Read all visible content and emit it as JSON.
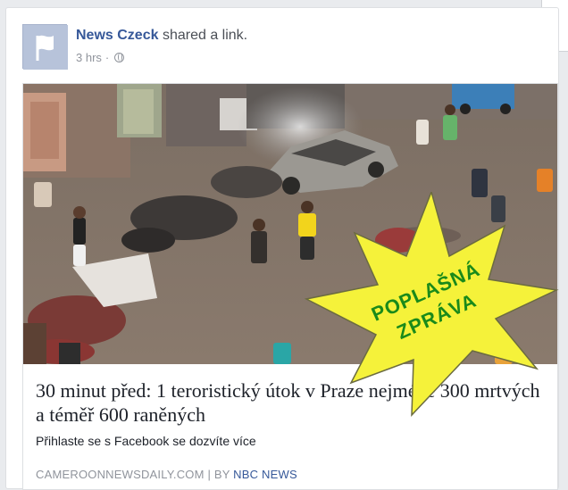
{
  "post": {
    "page_name": "News Czeck",
    "action_text": " shared a link.",
    "time": "3 hrs",
    "separator": "·"
  },
  "link": {
    "title": "30 minut před: 1 teroristický útok v Praze nejméně 300 mrtvých a téměř 600 raněných",
    "description": "Přihlaste se s Facebook se dozvíte více",
    "source_domain": "CAMEROONNEWSDAILY.COM",
    "source_separator": " | BY ",
    "source_author": "NBC NEWS"
  },
  "stamp": {
    "line1": "POPLAŠNÁ",
    "line2": "ZPRÁVA",
    "fill_color": "#f5f23a",
    "text_color": "#1a8a1a"
  },
  "colors": {
    "link_blue": "#365899",
    "meta_gray": "#90949c"
  },
  "icons": {
    "avatar": "flag-icon",
    "audience": "globe-icon"
  }
}
